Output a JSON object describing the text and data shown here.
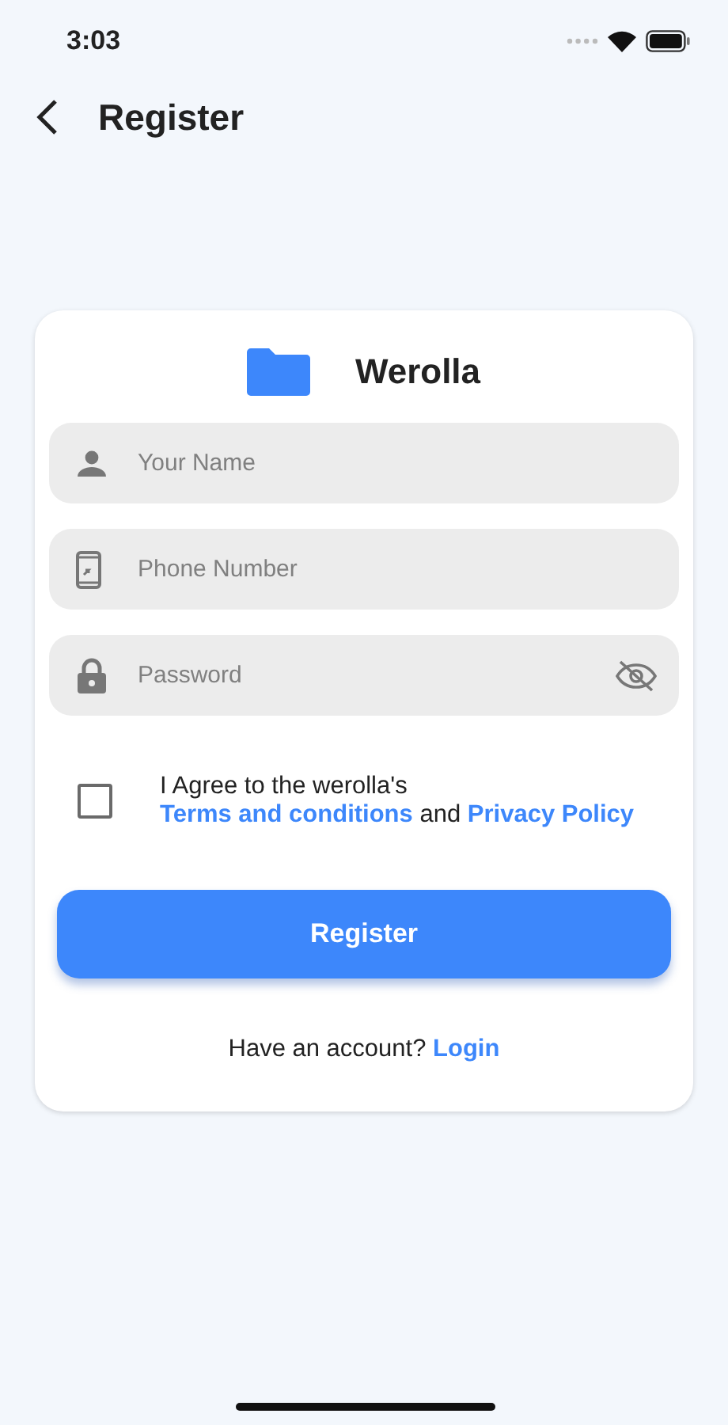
{
  "status_bar": {
    "time": "3:03"
  },
  "header": {
    "title": "Register"
  },
  "card": {
    "brand": "Werolla",
    "fields": [
      {
        "kind": "person",
        "placeholder": "Your Name"
      },
      {
        "kind": "phone",
        "placeholder": "Phone Number"
      },
      {
        "kind": "password",
        "placeholder": "Password",
        "visibility_toggle": true
      }
    ],
    "agreement": {
      "checked": false,
      "prefix": "I Agree to the werolla's",
      "terms_link": "Terms and conditions",
      "middle": "and",
      "privacy_link": "Privacy Policy"
    },
    "submit": "Register",
    "footer": {
      "question": "Have an account?",
      "link": "Login"
    }
  }
}
